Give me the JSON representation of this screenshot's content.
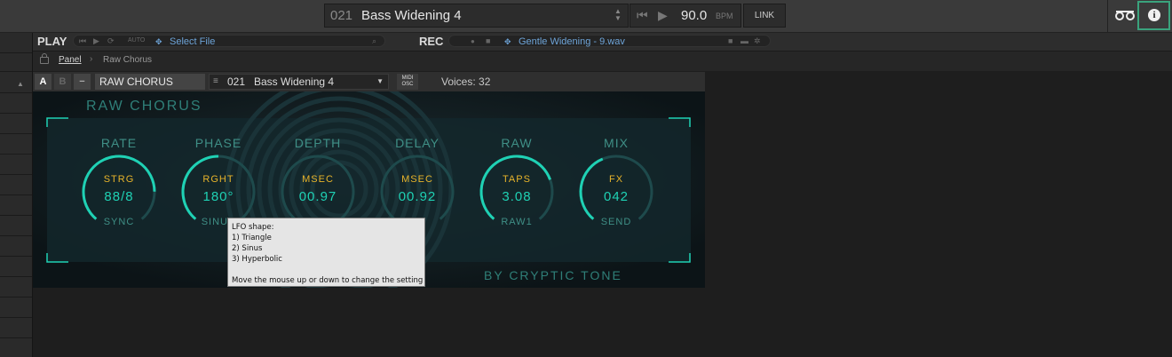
{
  "topbar": {
    "preset_number": "021",
    "preset_name": "Bass Widening 4",
    "bpm_value": "90.0",
    "bpm_label": "BPM",
    "link_label": "LINK"
  },
  "play": {
    "title": "PLAY",
    "auto_label": "AUTO",
    "file": "Select File"
  },
  "rec": {
    "title": "REC",
    "file": "Gentle Widening - 9.wav"
  },
  "breadcrumb": {
    "root": "Panel",
    "current": "Raw Chorus"
  },
  "instrument": {
    "slot_a": "A",
    "slot_b": "B",
    "minus": "−",
    "name": "RAW CHORUS",
    "preset_number": "021",
    "preset_name": "Bass Widening 4",
    "midi_top": "MIDI",
    "midi_bottom": "OSC",
    "voices": "Voices: 32"
  },
  "plugin": {
    "title": "RAW CHORUS",
    "brand": "BY CRYPTIC TONE",
    "knobs": [
      {
        "label": "RATE",
        "unit": "STRG",
        "value": "88/8",
        "sub": "SYNC",
        "level": 0.82
      },
      {
        "label": "PHASE",
        "unit": "RGHT",
        "value": "180°",
        "sub": "SINUS",
        "level": 0.5
      },
      {
        "label": "DEPTH",
        "unit": "MSEC",
        "value": "00.97",
        "sub": "",
        "level": 0.0
      },
      {
        "label": "DELAY",
        "unit": "MSEC",
        "value": "00.92",
        "sub": "",
        "level": 0.0
      },
      {
        "label": "RAW",
        "unit": "TAPS",
        "value": "3.08",
        "sub": "RAW1",
        "level": 0.75
      },
      {
        "label": "MIX",
        "unit": "FX",
        "value": "042",
        "sub": "SEND",
        "level": 0.42
      }
    ],
    "accent": "#1fd1b4",
    "label_color": "#3f8f86",
    "unit_color": "#e8b42a"
  },
  "tooltip": {
    "line1": "LFO shape:",
    "line2": "1) Triangle",
    "line3": "2) Sinus",
    "line4": "3) Hyperbolic",
    "line5": "Move the mouse up or down to change the setting"
  }
}
